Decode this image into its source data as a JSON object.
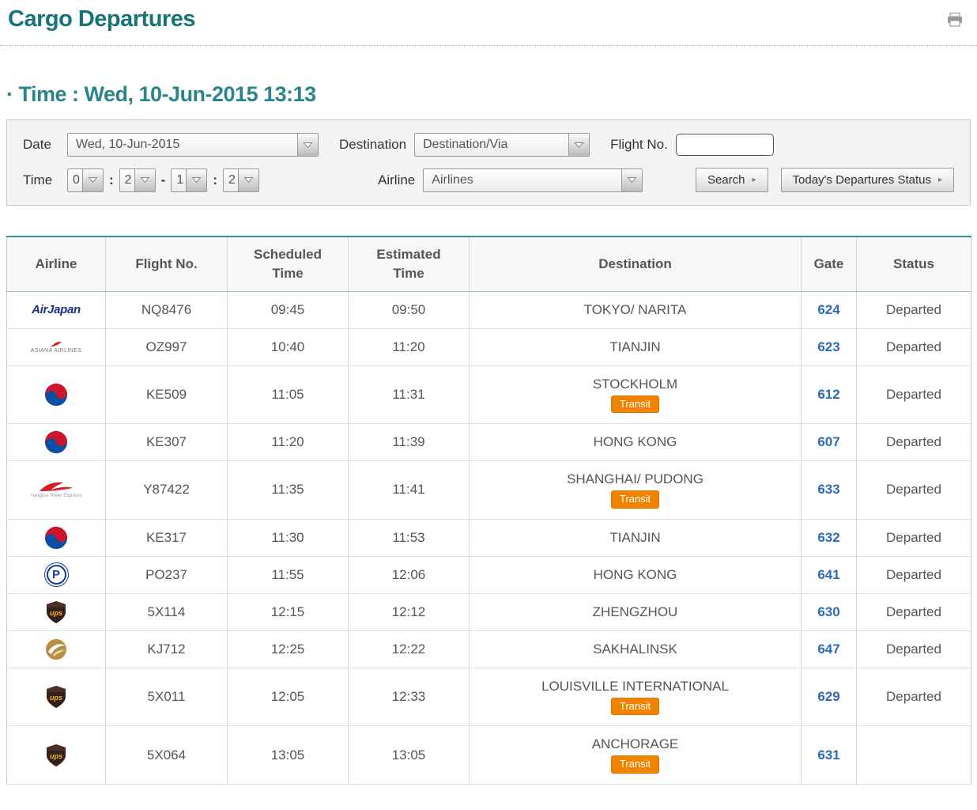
{
  "page": {
    "title": "Cargo Departures",
    "time_heading": "· Time : Wed, 10-Jun-2015 13:13"
  },
  "icons": {
    "print": "printer-icon",
    "dropdown": "chevron-down-icon",
    "button_caret": "caret-right-icon"
  },
  "colors": {
    "accent_teal": "#17737a",
    "gate_blue": "#2d6cb3",
    "transit_orange": "#f08300"
  },
  "filters": {
    "date_label": "Date",
    "date_value": "Wed, 10-Jun-2015",
    "destination_label": "Destination",
    "destination_value": "Destination/Via",
    "flight_no_label": "Flight No.",
    "flight_no_value": "",
    "time_label": "Time",
    "time_values": [
      "0",
      "2",
      "1",
      "2"
    ],
    "sep1": ":",
    "sep2": "-",
    "sep3": ":",
    "airline_label": "Airline",
    "airline_value": "Airlines",
    "search_button": "Search",
    "status_button": "Today's Departures Status"
  },
  "badges": {
    "transit": "Transit"
  },
  "table": {
    "headers": [
      "Airline",
      "Flight No.",
      "Scheduled\nTime",
      "Estimated\nTime",
      "Destination",
      "Gate",
      "Status"
    ],
    "rows": [
      {
        "airline": "Air Japan",
        "logo": "air-japan",
        "flight": "NQ8476",
        "scheduled": "09:45",
        "estimated": "09:50",
        "destination": "TOKYO/ NARITA",
        "transit": false,
        "gate": "624",
        "status": "Departed"
      },
      {
        "airline": "Asiana Airlines",
        "logo": "asiana",
        "flight": "OZ997",
        "scheduled": "10:40",
        "estimated": "11:20",
        "destination": "TIANJIN",
        "transit": false,
        "gate": "623",
        "status": "Departed"
      },
      {
        "airline": "Korean Air",
        "logo": "korean-air",
        "flight": "KE509",
        "scheduled": "11:05",
        "estimated": "11:31",
        "destination": "STOCKHOLM",
        "transit": true,
        "gate": "612",
        "status": "Departed"
      },
      {
        "airline": "Korean Air",
        "logo": "korean-air",
        "flight": "KE307",
        "scheduled": "11:20",
        "estimated": "11:39",
        "destination": "HONG KONG",
        "transit": false,
        "gate": "607",
        "status": "Departed"
      },
      {
        "airline": "Yangtze River Express",
        "logo": "yangtze",
        "flight": "Y87422",
        "scheduled": "11:35",
        "estimated": "11:41",
        "destination": "SHANGHAI/ PUDONG",
        "transit": true,
        "gate": "633",
        "status": "Departed"
      },
      {
        "airline": "Korean Air",
        "logo": "korean-air",
        "flight": "KE317",
        "scheduled": "11:30",
        "estimated": "11:53",
        "destination": "TIANJIN",
        "transit": false,
        "gate": "632",
        "status": "Departed"
      },
      {
        "airline": "Polar Air Cargo",
        "logo": "polar",
        "flight": "PO237",
        "scheduled": "11:55",
        "estimated": "12:06",
        "destination": "HONG KONG",
        "transit": false,
        "gate": "641",
        "status": "Departed"
      },
      {
        "airline": "UPS",
        "logo": "ups",
        "flight": "5X114",
        "scheduled": "12:15",
        "estimated": "12:12",
        "destination": "ZHENGZHOU",
        "transit": false,
        "gate": "630",
        "status": "Departed"
      },
      {
        "airline": "Air Incheon",
        "logo": "air-incheon",
        "flight": "KJ712",
        "scheduled": "12:25",
        "estimated": "12:22",
        "destination": "SAKHALINSK",
        "transit": false,
        "gate": "647",
        "status": "Departed"
      },
      {
        "airline": "UPS",
        "logo": "ups",
        "flight": "5X011",
        "scheduled": "12:05",
        "estimated": "12:33",
        "destination": "LOUISVILLE INTERNATIONAL",
        "transit": true,
        "gate": "629",
        "status": "Departed"
      },
      {
        "airline": "UPS",
        "logo": "ups",
        "flight": "5X064",
        "scheduled": "13:05",
        "estimated": "13:05",
        "destination": "ANCHORAGE",
        "transit": true,
        "gate": "631",
        "status": ""
      }
    ]
  }
}
